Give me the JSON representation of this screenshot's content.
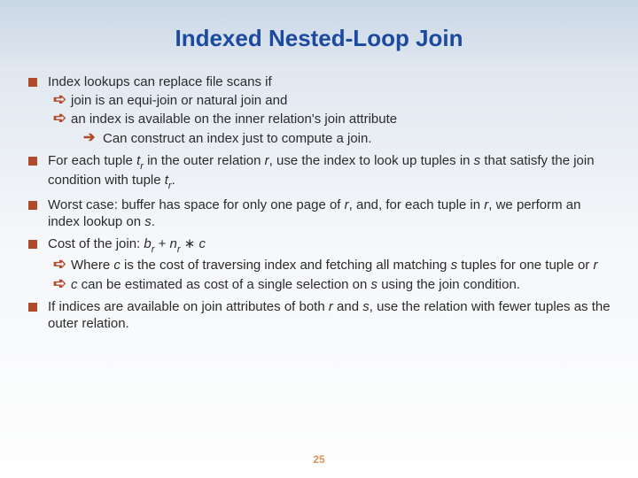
{
  "title": "Indexed Nested-Loop Join",
  "bullets": {
    "b1": "Index lookups can replace file scans if",
    "b1s1": "join is an equi-join or natural join and",
    "b1s2": "an index is available on the inner relation's join attribute",
    "b1ss1": "Can construct an index just to compute a join.",
    "b2a": "For each tuple ",
    "b2b": " in the outer relation ",
    "b2c": ", use the index to look up tuples in ",
    "b2d": " that satisfy the join condition with tuple ",
    "b2e": ".",
    "b3a": "Worst case:  buffer has space for only one page of ",
    "b3b": ", and, for each tuple in ",
    "b3c": ", we perform an index lookup on ",
    "b3d": ".",
    "b4a": "Cost of the join:  ",
    "b4b": "  + ",
    "b4c": " ∗ ",
    "b4s1a": "Where ",
    "b4s1b": " is the cost of traversing index and fetching all matching ",
    "b4s1c": " tuples for one tuple or ",
    "b4s2a": " can be estimated as cost of a single selection on ",
    "b4s2b": " using the join condition.",
    "b5a": "If indices are available on join attributes of both ",
    "b5b": " and ",
    "b5c": ", use the relation with fewer tuples as the outer relation."
  },
  "vars": {
    "t": "t",
    "r": "r",
    "s": "s",
    "b": "b",
    "n": "n",
    "c": "c"
  },
  "subs": {
    "r": "r"
  },
  "page": "25"
}
